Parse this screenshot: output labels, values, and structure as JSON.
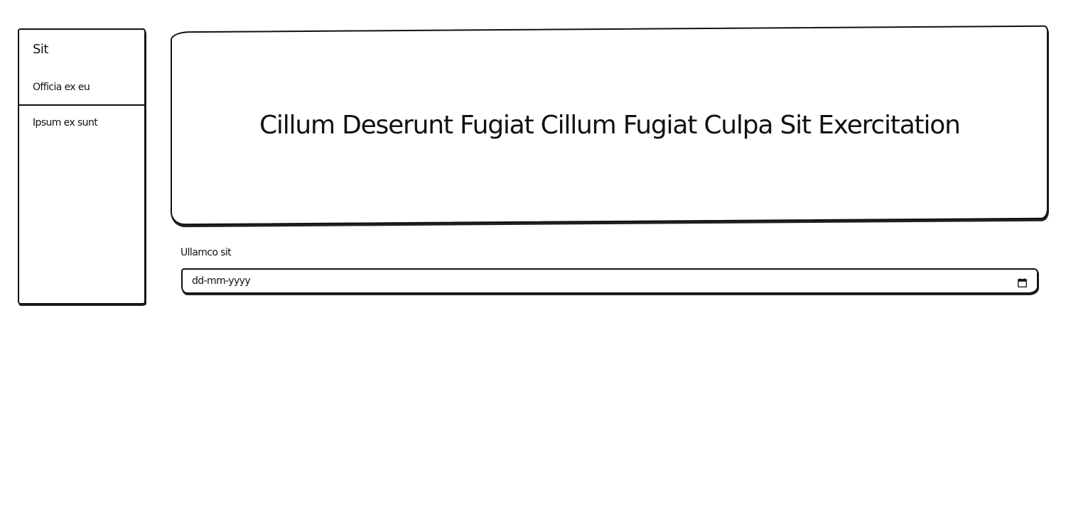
{
  "sidebar": {
    "title": "Sit",
    "items": [
      {
        "label": "Officia ex eu"
      },
      {
        "label": "Ipsum ex sunt"
      }
    ]
  },
  "banner": {
    "title": "Cillum Deserunt Fugiat Cillum Fugiat Culpa Sit Exercitation"
  },
  "date_field": {
    "label": "Ullamco sit",
    "placeholder": "dd-mm-yyyy",
    "icon": "calendar-icon"
  },
  "colors": {
    "stroke": "#111111",
    "background": "#ffffff"
  }
}
